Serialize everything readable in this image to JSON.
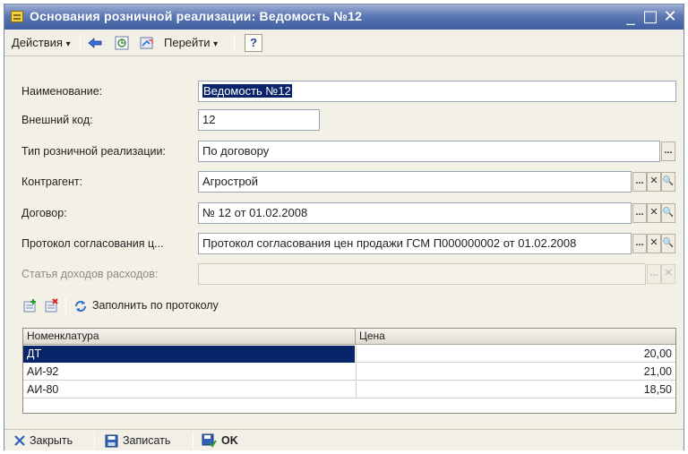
{
  "window": {
    "title": "Основания розничной реализации: Ведомость №12",
    "controls": {
      "minimize": "_",
      "maximize": "□",
      "close": "✕"
    }
  },
  "toolbar": {
    "actions_label": "Действия",
    "goto_label": "Перейти",
    "help_label": "?"
  },
  "form": {
    "name": {
      "label": "Наименование:",
      "value": "Ведомость №12"
    },
    "ext_code": {
      "label": "Внешний код:",
      "value": "12"
    },
    "sale_type": {
      "label": "Тип розничной реализации:",
      "value": "По договору"
    },
    "counterparty": {
      "label": "Контрагент:",
      "value": "Агрострой"
    },
    "contract": {
      "label": "Договор:",
      "value": "№ 12 от 01.02.2008"
    },
    "protocol": {
      "label": "Протокол согласования ц...",
      "value": "Протокол согласования цен продажи ГСМ П000000002 от 01.02.2008"
    },
    "income_item": {
      "label": "Статья доходов расходов:",
      "value": ""
    }
  },
  "table_toolbar": {
    "fill_label": "Заполнить по протоколу"
  },
  "table": {
    "columns": [
      "Номенклатура",
      "Цена"
    ],
    "rows": [
      {
        "name": "ДТ",
        "price": "20,00",
        "selected": true
      },
      {
        "name": "АИ-92",
        "price": "21,00",
        "selected": false
      },
      {
        "name": "АИ-80",
        "price": "18,50",
        "selected": false
      }
    ]
  },
  "footer": {
    "close_label": "Закрыть",
    "save_label": "Записать",
    "ok_label": "OK"
  },
  "icons": {
    "arrow_down": "▾",
    "select": "...",
    "clear": "✕",
    "open": "🔍"
  },
  "colors": {
    "title_bar": "#4a6aab",
    "selection": "#0a246a",
    "window_bg": "#f3f0e6"
  }
}
